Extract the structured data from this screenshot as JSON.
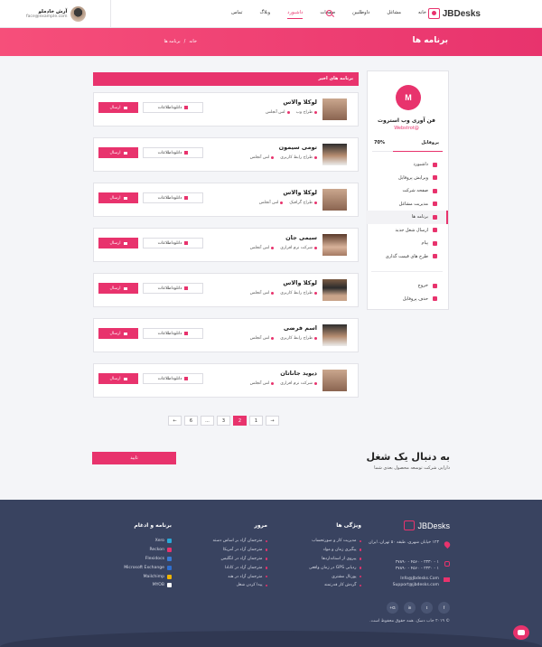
{
  "header": {
    "logo_text": "JBDesks",
    "nav": [
      "خانه",
      "مشاغل",
      "داوطلبین",
      "صفحات",
      "داشبورد",
      "وبلاگ",
      "تماس"
    ],
    "active_nav_index": 4,
    "user_name": "آرش خادملو",
    "user_email": "face@example.com"
  },
  "banner": {
    "title": "برنامه ها",
    "crumb_home": "خانه",
    "crumb_sep": "/",
    "crumb_current": "برنامه ها"
  },
  "sidebar": {
    "company_name": "فن آوری وب استروت",
    "company_url": "@Webstrot",
    "profile_label": "پروفایل",
    "profile_percent": "70%",
    "menu": [
      "داشبورد",
      "ویرایش پروفایل",
      "صفحه شرکت",
      "مدیریت مشاغل",
      "برنامه ها",
      "ارسال شغل جدید",
      "پیام",
      "طرح های قیمت گذاری"
    ],
    "active_menu_index": 4,
    "bottom_menu": [
      "خروج",
      "حذف پروفایل"
    ]
  },
  "main": {
    "heading": "برنامه های اخیر",
    "download_label": "دانلوداطلاعات",
    "send_label": "ارسال",
    "applicants": [
      {
        "name": "لوکلا والاس",
        "role": "طراح وب",
        "location": "لس آنجلس"
      },
      {
        "name": "تومی سیمون",
        "role": "طراح رابط کاربری",
        "location": "لس آنجلس"
      },
      {
        "name": "لوکلا والاس",
        "role": "طراح گرافیک",
        "location": "لس آنجلس"
      },
      {
        "name": "سیمی جان",
        "role": "شرکت نرم افزاری",
        "location": "لس آنجلس"
      },
      {
        "name": "لوکلا والاس",
        "role": "طراح رابط کاربری",
        "location": "لس آنجلس"
      },
      {
        "name": "اسم فرضی",
        "role": "طراح رابط کاربری",
        "location": "لس آنجلس"
      },
      {
        "name": "دیوید جاناتان",
        "role": "شرکت نرم افزاری",
        "location": "لس آنجلس"
      }
    ]
  },
  "pagination": {
    "prev": "←",
    "pages": [
      "1",
      "2",
      "3",
      "...",
      "6"
    ],
    "active_page": "2",
    "next": "→"
  },
  "job_search": {
    "title": "به دنبال یک شغل",
    "subtitle": "دارایی شرکت توسعه محصول بعدی شما",
    "button": "تایید"
  },
  "footer": {
    "logo_text": "JBDesks",
    "address": "۱۲۳ خیابان شهری، طبقه ۵۰ تهران، ایران",
    "phones": [
      "۲۷۸۹۰ - ۴۵۶۰ - ۲۳۳۰ - ۱",
      "۲۷۸۹۰ - ۴۵۶۰ - ۲۳۳۰ - ۱"
    ],
    "emails": [
      "Info@Jbdesks.Com",
      "Support@jbdesks.com"
    ],
    "social": [
      "f",
      "t",
      "in",
      "G+"
    ],
    "features_title": "ویژگی ها",
    "features": [
      "مدیریت کار و صورتحساب",
      "پیگیری زمان و مواد",
      "پیروی از استانداردها",
      "ردیابی GPS در زمان واقعی",
      "پورتال مشتری",
      "گردش کار قدرتمند"
    ],
    "browse_title": "مرور",
    "browse": [
      "مترجمان آزاد بر اساس دسته",
      "مترجمان آزاد در آمریکا",
      "مترجمان آزاد در انگلیس",
      "مترجمان آزاد در کانادا",
      "مترجمان آزاد در هند",
      "پیدا کردن شغل"
    ],
    "apps_title": "برنامه و ادغام",
    "apps": [
      "Xero",
      "Reckon",
      "Flexidocs",
      "Microsoft Exchange",
      "Mailchimp",
      "MYOB"
    ],
    "app_colors": [
      "#2aa7d6",
      "#e8336d",
      "#3a7bd5",
      "#2f6fd0",
      "#f0b400",
      "#ffffff"
    ],
    "copyright": "© ۲۰۱۹ جاب دسک. همه حقوق محفوظ است."
  },
  "colors": {
    "accent": "#e8336d",
    "footer_bg": "#394360"
  }
}
